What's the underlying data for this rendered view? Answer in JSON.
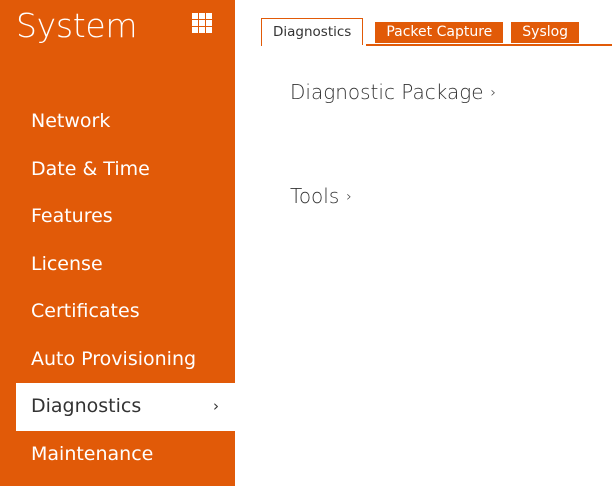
{
  "theme": {
    "accent": "#e15a08"
  },
  "sidebar": {
    "title": "System",
    "apps_icon": "grid-apps-icon",
    "items": [
      {
        "label": "Network",
        "active": false
      },
      {
        "label": "Date & Time",
        "active": false
      },
      {
        "label": "Features",
        "active": false
      },
      {
        "label": "License",
        "active": false
      },
      {
        "label": "Certificates",
        "active": false
      },
      {
        "label": "Auto Provisioning",
        "active": false
      },
      {
        "label": "Diagnostics",
        "active": true
      },
      {
        "label": "Maintenance",
        "active": false
      }
    ],
    "active_chevron": "›"
  },
  "tabs": [
    {
      "label": "Diagnostics",
      "active": true
    },
    {
      "label": "Packet Capture",
      "active": false
    },
    {
      "label": "Syslog",
      "active": false
    }
  ],
  "main": {
    "sections": [
      {
        "label": "Diagnostic Package",
        "chevron": "›"
      },
      {
        "label": "Tools",
        "chevron": "›"
      }
    ]
  }
}
